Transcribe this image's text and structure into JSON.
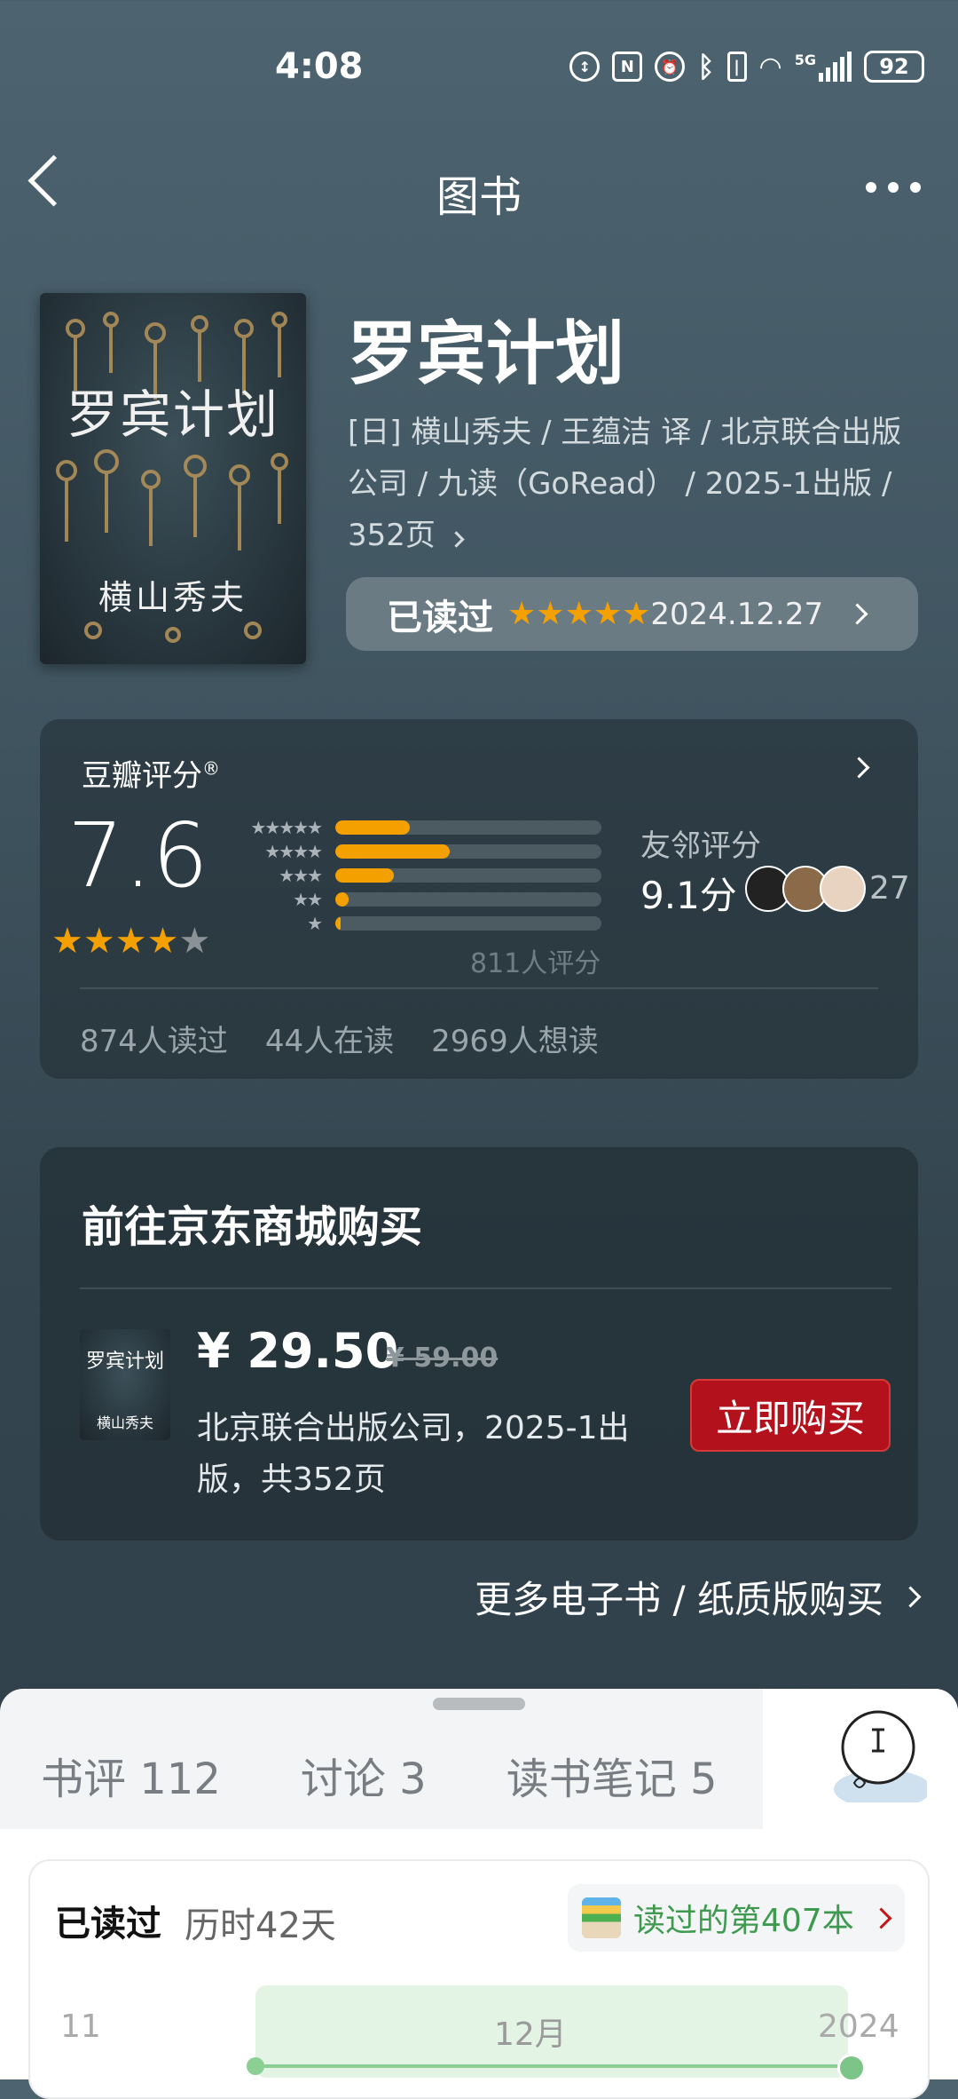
{
  "status_bar": {
    "time": "4:08",
    "battery": "92",
    "network": "5G"
  },
  "nav": {
    "title": "图书"
  },
  "book": {
    "title": "罗宾计划",
    "cover_title": "罗宾计划",
    "cover_author": "横山秀夫",
    "meta": "[日] 横山秀夫 / 王蕴洁 译 / 北京联合出版公司 / 九读（GoRead） / 2025-1出版 / 352页",
    "read_status": "已读过",
    "my_rating_stars": 5,
    "read_date": "2024.12.27"
  },
  "rating": {
    "title": "豆瓣评分",
    "registered_mark": "®",
    "score": "7.6",
    "score_stars": 4,
    "distribution": [
      {
        "label": "★★★★★",
        "fraction": 0.28
      },
      {
        "label": "★★★★",
        "fraction": 0.43
      },
      {
        "label": "★★★",
        "fraction": 0.22
      },
      {
        "label": "★★",
        "fraction": 0.05
      },
      {
        "label": "★",
        "fraction": 0.02
      }
    ],
    "rater_count": "811人评分",
    "friend_title": "友邻评分",
    "friend_score": "9.1分",
    "friend_count": "27",
    "stats": [
      "874人读过",
      "44人在读",
      "2969人想读"
    ]
  },
  "buy": {
    "title": "前往京东商城购买",
    "price": "¥ 29.50",
    "old_price": "¥ 59.00",
    "publisher": "北京联合出版公司，2025-1出版，共352页",
    "button": "立即购买",
    "more": "更多电子书 / 纸质版购买"
  },
  "tabs": [
    "书评 112",
    "讨论 3",
    "读书笔记 5"
  ],
  "read_card": {
    "title": "已读过",
    "duration": "历时42天",
    "nth": "读过的第407本",
    "timeline": [
      "11",
      "12月",
      "2024"
    ]
  },
  "colors": {
    "star": "#f4a000",
    "buy_button": "#b3121c",
    "accent_green": "#3e9a4e"
  }
}
